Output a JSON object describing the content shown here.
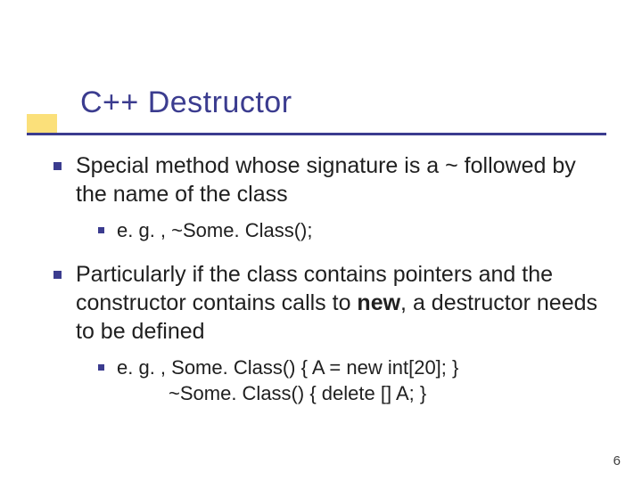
{
  "title": "C++ Destructor",
  "bullets": [
    {
      "text_a": "Special method whose signature is a ",
      "tilde": "~",
      "text_b": " followed by the name of the class",
      "sub": {
        "text": "e. g. , ~Some. Class();"
      }
    },
    {
      "text_a": "Particularly if the class contains pointers and the constructor contains calls to ",
      "bold": "new",
      "text_b": ", a destructor needs to be defined",
      "sub": {
        "line1_a": "e. g. ,  Some. Class() { A = new int[20]; }",
        "line2": "~Some. Class() { delete [] A; }"
      }
    }
  ],
  "page_number": "6"
}
